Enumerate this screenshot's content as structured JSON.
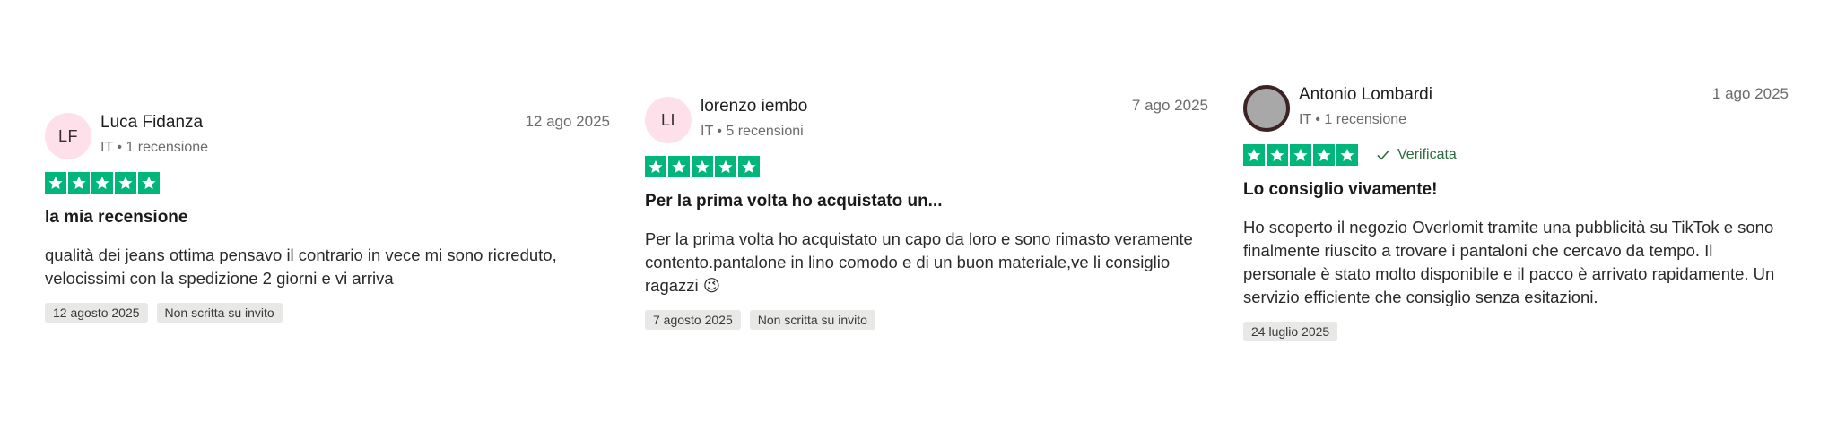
{
  "reviews": [
    {
      "initials": "LF",
      "name": "Luca Fidanza",
      "meta": "IT • 1 recensione",
      "date": "12 ago 2025",
      "rating": 5,
      "verified": "",
      "title": "la mia recensione",
      "body": "qualità dei jeans ottima pensavo il contrario in vece mi sono ricreduto, velocissimi con la spedizione 2 giorni e vi arriva",
      "tag_date": "12 agosto 2025",
      "tag_invite": "Non scritta su invito"
    },
    {
      "initials": "LI",
      "name": "lorenzo iembo",
      "meta": "IT • 5 recensioni",
      "date": "7 ago 2025",
      "rating": 5,
      "verified": "",
      "title": "Per la prima volta ho acquistato un...",
      "body": "Per la prima volta ho acquistato un capo da loro e sono rimasto veramente contento.pantalone in lino comodo e di un buon materiale,ve li consiglio ragazzi 😉",
      "tag_date": "7 agosto 2025",
      "tag_invite": "Non scritta su invito"
    },
    {
      "initials": "",
      "name": "Antonio Lombardi",
      "meta": "IT • 1 recensione",
      "date": "1 ago 2025",
      "rating": 5,
      "verified": "Verificata",
      "title": "Lo consiglio vivamente!",
      "body": "Ho scoperto il negozio Overlomit tramite una pubblicità su TikTok e sono finalmente riuscito a trovare i pantaloni che cercavo da tempo. Il personale è stato molto disponibile e il pacco è arrivato rapidamente. Un servizio efficiente che consiglio senza esitazioni.",
      "tag_date": "24 luglio 2025",
      "tag_invite": ""
    }
  ],
  "colors": {
    "star_green": "#00b67a",
    "avatar_pink": "#fde0ea",
    "verified_green": "#2b6b3d",
    "tag_bg": "#e8e8e6"
  },
  "icons": {
    "star": "star-icon",
    "check": "check-icon"
  }
}
